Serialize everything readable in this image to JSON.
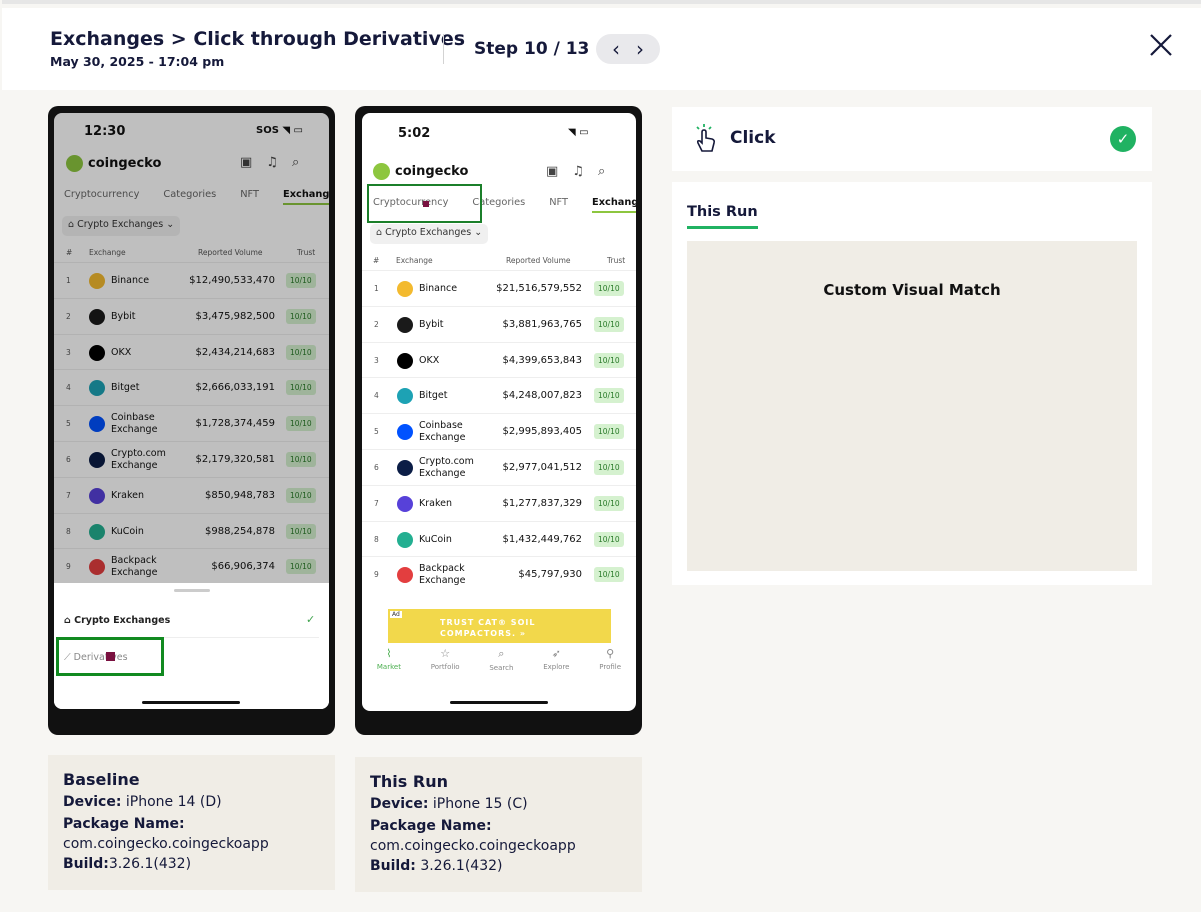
{
  "header": {
    "title": "Exchanges > Click through Derivatives",
    "date": "May 30, 2025 - 17:04 pm",
    "step": "Step 10 / 13",
    "prev_icon": "chevron-left-icon",
    "next_icon": "chevron-right-icon",
    "close_icon": "close-icon"
  },
  "baseline_screen": {
    "time": "12:30",
    "status_right": "SOS",
    "app_name": "coingecko",
    "tabs": [
      "Cryptocurrency",
      "Categories",
      "NFT",
      "Exchanges"
    ],
    "filter": "Crypto Exchanges",
    "columns": [
      "#",
      "Exchange",
      "Reported Volume",
      "Trust"
    ],
    "rows": [
      {
        "rank": "1",
        "name": "Binance",
        "volume": "$12,490,533,470",
        "trust": "10/10",
        "color": "#f3ba2f"
      },
      {
        "rank": "2",
        "name": "Bybit",
        "volume": "$3,475,982,500",
        "trust": "10/10",
        "color": "#1a1a1a"
      },
      {
        "rank": "3",
        "name": "OKX",
        "volume": "$2,434,214,683",
        "trust": "10/10",
        "color": "#000000"
      },
      {
        "rank": "4",
        "name": "Bitget",
        "volume": "$2,666,033,191",
        "trust": "10/10",
        "color": "#1da2b4"
      },
      {
        "rank": "5",
        "name": "Coinbase Exchange",
        "volume": "$1,728,374,459",
        "trust": "10/10",
        "color": "#0052ff"
      },
      {
        "rank": "6",
        "name": "Crypto.com Exchange",
        "volume": "$2,179,320,581",
        "trust": "10/10",
        "color": "#0b1d46"
      },
      {
        "rank": "7",
        "name": "Kraken",
        "volume": "$850,948,783",
        "trust": "10/10",
        "color": "#5741d9"
      },
      {
        "rank": "8",
        "name": "KuCoin",
        "volume": "$988,254,878",
        "trust": "10/10",
        "color": "#23af91"
      },
      {
        "rank": "9",
        "name": "Backpack Exchange",
        "volume": "$66,906,374",
        "trust": "10/10",
        "color": "#e33e3f"
      }
    ],
    "sheet_option_1": "Crypto Exchanges",
    "sheet_option_2": "Derivatives"
  },
  "run_screen": {
    "time": "5:02",
    "app_name": "coingecko",
    "tabs": [
      "Cryptocurrency",
      "Categories",
      "NFT",
      "Exchanges"
    ],
    "filter": "Crypto Exchanges",
    "columns": [
      "#",
      "Exchange",
      "Reported Volume",
      "Trust"
    ],
    "rows": [
      {
        "rank": "1",
        "name": "Binance",
        "volume": "$21,516,579,552",
        "trust": "10/10",
        "color": "#f3ba2f"
      },
      {
        "rank": "2",
        "name": "Bybit",
        "volume": "$3,881,963,765",
        "trust": "10/10",
        "color": "#1a1a1a"
      },
      {
        "rank": "3",
        "name": "OKX",
        "volume": "$4,399,653,843",
        "trust": "10/10",
        "color": "#000000"
      },
      {
        "rank": "4",
        "name": "Bitget",
        "volume": "$4,248,007,823",
        "trust": "10/10",
        "color": "#1da2b4"
      },
      {
        "rank": "5",
        "name": "Coinbase Exchange",
        "volume": "$2,995,893,405",
        "trust": "10/10",
        "color": "#0052ff"
      },
      {
        "rank": "6",
        "name": "Crypto.com Exchange",
        "volume": "$2,977,041,512",
        "trust": "10/10",
        "color": "#0b1d46"
      },
      {
        "rank": "7",
        "name": "Kraken",
        "volume": "$1,277,837,329",
        "trust": "10/10",
        "color": "#5741d9"
      },
      {
        "rank": "8",
        "name": "KuCoin",
        "volume": "$1,432,449,762",
        "trust": "10/10",
        "color": "#23af91"
      },
      {
        "rank": "9",
        "name": "Backpack Exchange",
        "volume": "$45,797,930",
        "trust": "10/10",
        "color": "#e33e3f"
      }
    ],
    "ad_text": "TRUST CAT® SOIL COMPACTORS. »",
    "ad_label": "Ad",
    "bottom_nav": [
      "Market",
      "Portfolio",
      "Search",
      "Explore",
      "Profile"
    ]
  },
  "baseline_info": {
    "heading": "Baseline",
    "device_label": "Device:",
    "device": "iPhone 14 (D)",
    "package_label": "Package Name:",
    "package": "com.coingecko.coingeckoapp",
    "build_label": "Build:",
    "build": "3.26.1(432)"
  },
  "run_info": {
    "heading": "This Run",
    "device_label": "Device:",
    "device": "iPhone 15 (C)",
    "package_label": "Package Name:",
    "package": "com.coingecko.coingeckoapp",
    "build_label": "Build:",
    "build": "3.26.1(432)"
  },
  "action": {
    "label": "Click",
    "icon": "tap-hand-icon",
    "status_icon": "check-circle-icon",
    "status_color": "#20b262"
  },
  "result": {
    "tab": "This Run",
    "match_label": "Custom Visual Match"
  }
}
